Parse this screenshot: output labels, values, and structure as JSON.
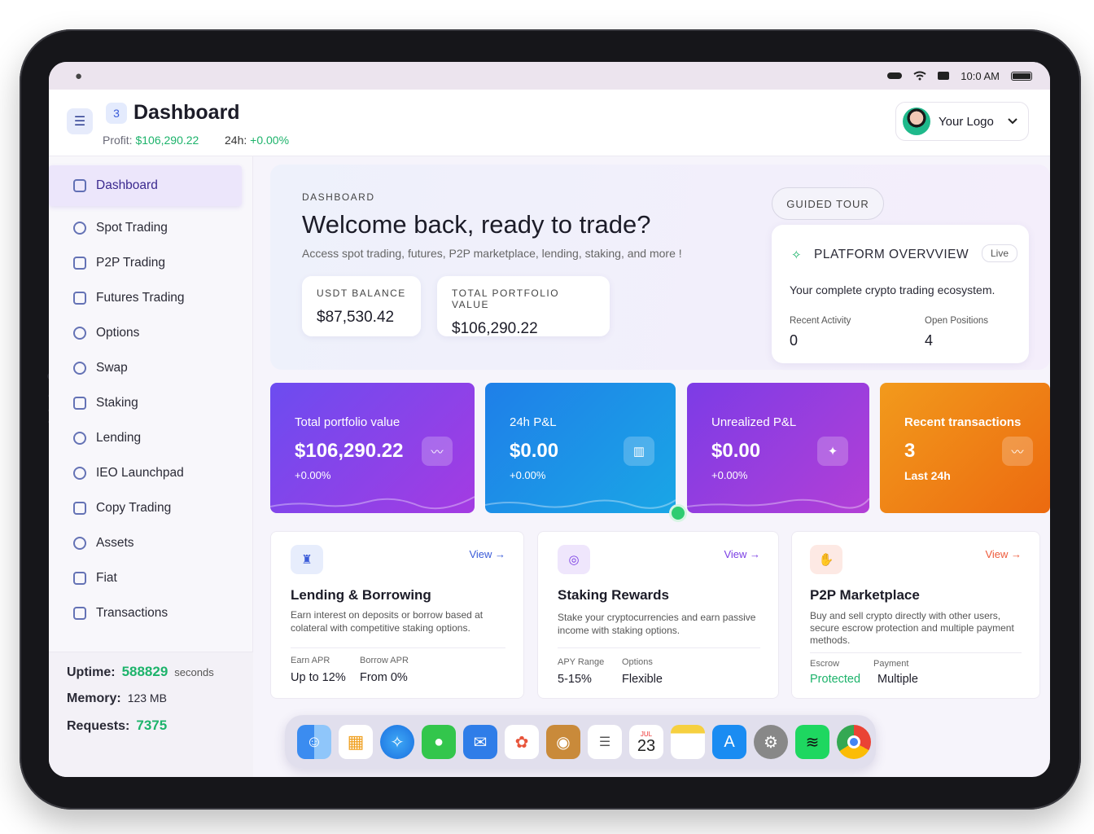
{
  "status": {
    "time": "10:0 AM"
  },
  "header": {
    "badge": "3",
    "title": "Dashboard",
    "profit_label": "Profit:",
    "profit_value": "$106,290.22",
    "h24_label": "24h:",
    "h24_value": "+0.00%",
    "logo_label": "Your Logo"
  },
  "sidebar": {
    "items": [
      {
        "label": "Dashboard"
      },
      {
        "label": "Spot Trading"
      },
      {
        "label": "P2P Trading"
      },
      {
        "label": "Futures Trading"
      },
      {
        "label": "Options"
      },
      {
        "label": "Swap"
      },
      {
        "label": "Staking"
      },
      {
        "label": "Lending"
      },
      {
        "label": "IEO Launchpad"
      },
      {
        "label": "Copy Trading"
      },
      {
        "label": "Assets"
      },
      {
        "label": "Fiat"
      },
      {
        "label": "Transactions"
      }
    ],
    "stats": {
      "uptime_label": "Uptime:",
      "uptime_value": "588829",
      "uptime_unit": "seconds",
      "memory_label": "Memory:",
      "memory_value": "123 MB",
      "requests_label": "Requests:",
      "requests_value": "7375"
    }
  },
  "hero": {
    "eyebrow": "DASHBOARD",
    "title": "Welcome back, ready to trade?",
    "subtitle": "Access spot trading, futures, P2P marketplace, lending, staking, and more !",
    "usdt_label": "USDT BALANCE",
    "usdt_value": "$87,530.42",
    "portfolio_label": "TOTAL PORTFOLIO VALUE",
    "portfolio_value": "$106,290.22",
    "tour_label": "GUIDED TOUR"
  },
  "overview": {
    "title": "PLATFORM OVERVVIEW",
    "live": "Live",
    "desc": "Your complete crypto trading ecosystem.",
    "recent_label": "Recent Activity",
    "recent_value": "0",
    "open_label": "Open Positions",
    "open_value": "4"
  },
  "kpis": [
    {
      "title": "Total portfolio value",
      "value": "$106,290.22",
      "sub": "+0.00%",
      "icon": "activity-icon"
    },
    {
      "title": "24h P&L",
      "value": "$0.00",
      "sub": "+0.00%",
      "icon": "bar-chart-icon"
    },
    {
      "title": "Unrealized P&L",
      "value": "$0.00",
      "sub": "+0.00%",
      "icon": "sparkle-icon"
    },
    {
      "title": "Recent transactions",
      "value": "3",
      "sub": "Last 24h",
      "icon": "activity-icon"
    }
  ],
  "cards": [
    {
      "title": "Lending & Borrowing",
      "desc": "Earn interest on deposits or borrow based at colateral with competitive staking options.",
      "view": "View →",
      "f1_label": "Earn APR",
      "f1_value": "Up to 12%",
      "f2_label": "Borrow APR",
      "f2_value": "From 0%",
      "icon": "piggy-bank-icon",
      "accent": "#3a5bd8"
    },
    {
      "title": "Staking Rewards",
      "desc": "Stake your cryptocurrencies and earn passive income with staking options.",
      "view": "View →",
      "f1_label": "APY Range",
      "f1_value": "5-15%",
      "f2_label": "Options",
      "f2_value": "Flexible",
      "icon": "coins-icon",
      "accent": "#7b3fe4"
    },
    {
      "title": "P2P Marketplace",
      "desc": "Buy and sell crypto directly with other users, secure escrow protection and multiple payment methods.",
      "view": "View →",
      "f1_label": "Escrow",
      "f1_value": "Protected",
      "f2_label": "Payment",
      "f2_value": "Multiple",
      "icon": "handshake-icon",
      "accent": "#ee5a3a"
    }
  ],
  "dock": {
    "calendar_month": "JUL",
    "calendar_day": "23",
    "apps": [
      "finder-icon",
      "launchpad-icon",
      "safari-icon",
      "messages-icon",
      "mail-icon",
      "photos-icon",
      "books-icon",
      "reminders-icon",
      "calendar-icon",
      "notes-icon",
      "app-store-icon",
      "settings-icon",
      "spotify-icon",
      "chrome-icon"
    ]
  },
  "colors": {
    "accent_green": "#1db36b",
    "active_nav": "#ece6fb"
  }
}
